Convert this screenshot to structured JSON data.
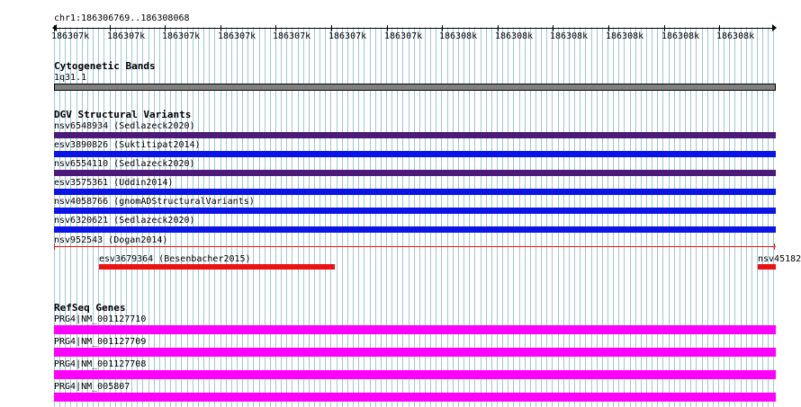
{
  "ruler": {
    "location": "chr1:186306769..186308068",
    "ticks": [
      "186307k",
      "186307k",
      "186307k",
      "186307k",
      "186307k",
      "186307k",
      "186307k",
      "186308k",
      "186308k",
      "186308k",
      "186308k",
      "186308k",
      "186308k"
    ]
  },
  "cyto": {
    "title": "Cytogenetic Bands",
    "band_label": "1q31.1",
    "band_color": "#808080"
  },
  "dgv": {
    "title": "DGV Structural Variants",
    "items": [
      {
        "label": "nsv6548934 (Sedlazeck2020)",
        "color": "#4b1a7a"
      },
      {
        "label": "esv3890826 (Suktitipat2014)",
        "color": "#0a14e6"
      },
      {
        "label": "nsv6554110 (Sedlazeck2020)",
        "color": "#4b1a7a"
      },
      {
        "label": "esv3575361 (Uddin2014)",
        "color": "#0a14e6"
      },
      {
        "label": "nsv4058766 (gnomADStructuralVariants)",
        "color": "#0a14e6"
      },
      {
        "label": "nsv6320621 (Sedlazeck2020)",
        "color": "#0a14e6"
      }
    ],
    "loss_line": {
      "label": "nsv952543 (Dogan2014)",
      "color": "#ee1111"
    },
    "loss_sub": [
      {
        "label": "esv3679364 (Besenbacher2015)",
        "color": "#ee1111"
      },
      {
        "label": "nsv45182",
        "color": "#ee1111"
      }
    ]
  },
  "refseq": {
    "title": "RefSeq Genes",
    "items": [
      {
        "label": "PRG4|NM_001127710",
        "color": "#ff00ff"
      },
      {
        "label": "PRG4|NM_001127709",
        "color": "#ff00ff"
      },
      {
        "label": "PRG4|NM_001127708",
        "color": "#ff00ff"
      },
      {
        "label": "PRG4|NM_005807",
        "color": "#ff00ff"
      }
    ]
  },
  "colors": {
    "grid_line": "#9ec6d6",
    "ruler_line": "#000000"
  }
}
